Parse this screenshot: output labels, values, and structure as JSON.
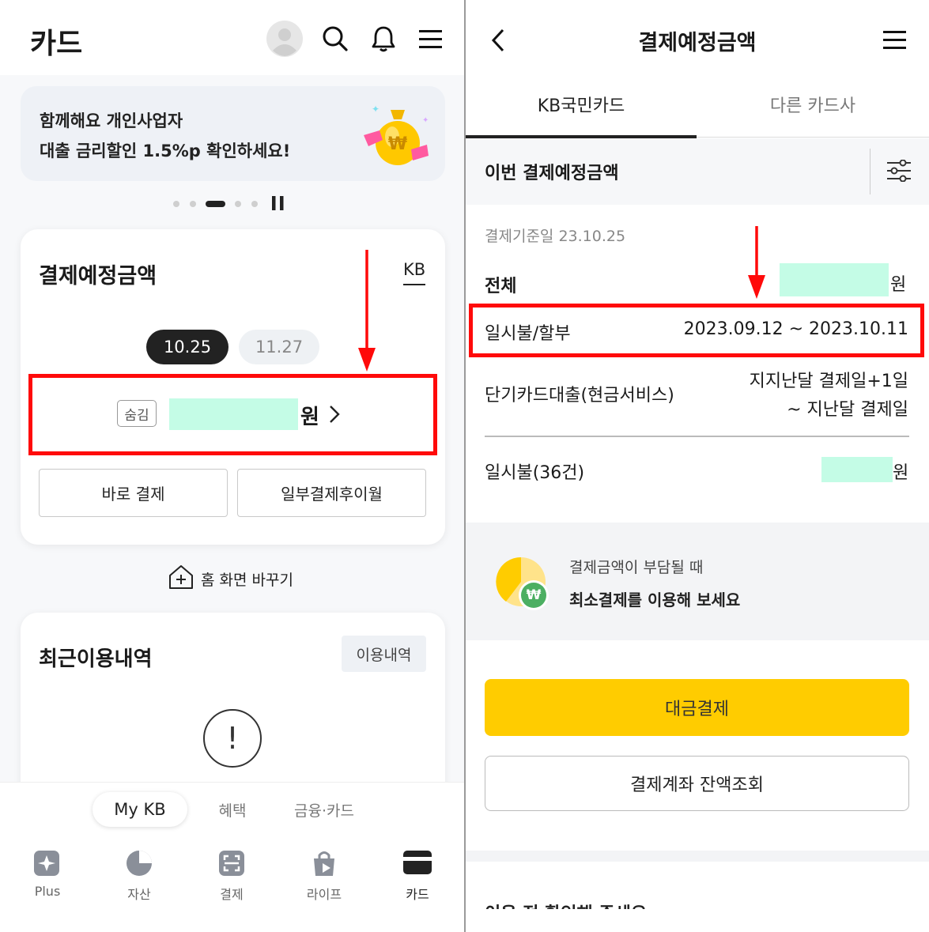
{
  "left": {
    "header": {
      "title": "카드"
    },
    "banner": {
      "line1": "함께해요 개인사업자",
      "line2": "대출 금리할인 1.5%p 확인하세요!",
      "coin_symbol": "₩"
    },
    "payment_card": {
      "title": "결제예정금액",
      "card_brand": "KB",
      "dates": [
        "10.25",
        "11.27"
      ],
      "hide_label": "숨김",
      "amount_unit": "원",
      "buttons": [
        "바로 결제",
        "일부결제후이월"
      ]
    },
    "home_change": {
      "label": "홈 화면 바꾸기"
    },
    "recent": {
      "title": "최근이용내역",
      "button": "이용내역",
      "empty_symbol": "!"
    },
    "bottom_tabs": [
      "My KB",
      "혜택",
      "금융·카드"
    ],
    "nav": [
      "Plus",
      "자산",
      "결제",
      "라이프",
      "카드"
    ]
  },
  "right": {
    "header": {
      "title": "결제예정금액"
    },
    "tabs": [
      "KB국민카드",
      "다른 카드사"
    ],
    "section_title": "이번 결제예정금액",
    "base_date": "결제기준일 23.10.25",
    "total": {
      "label": "전체",
      "unit": "원"
    },
    "installment": {
      "label": "일시불/할부",
      "period": "2023.09.12 ~ 2023.10.11"
    },
    "cash_service": {
      "label": "단기카드대출(현금서비스)",
      "period_line1": "지지난달 결제일+1일",
      "period_line2": "~ 지난달 결제일"
    },
    "lump": {
      "label": "일시불(36건)",
      "unit": "원"
    },
    "promo": {
      "line1": "결제금액이 부담될 때",
      "line2": "최소결제를 이용해 보세요",
      "coin_symbol": "₩"
    },
    "buttons": {
      "pay": "대금결제",
      "balance": "결제계좌 잔액조회"
    },
    "cut_text": "이용 전 확인해 주세요"
  },
  "colors": {
    "accent_yellow": "#ffcc00",
    "highlight_red": "#ff0a0a",
    "mask_mint": "#c4fce6",
    "dark_pill": "#222222"
  }
}
